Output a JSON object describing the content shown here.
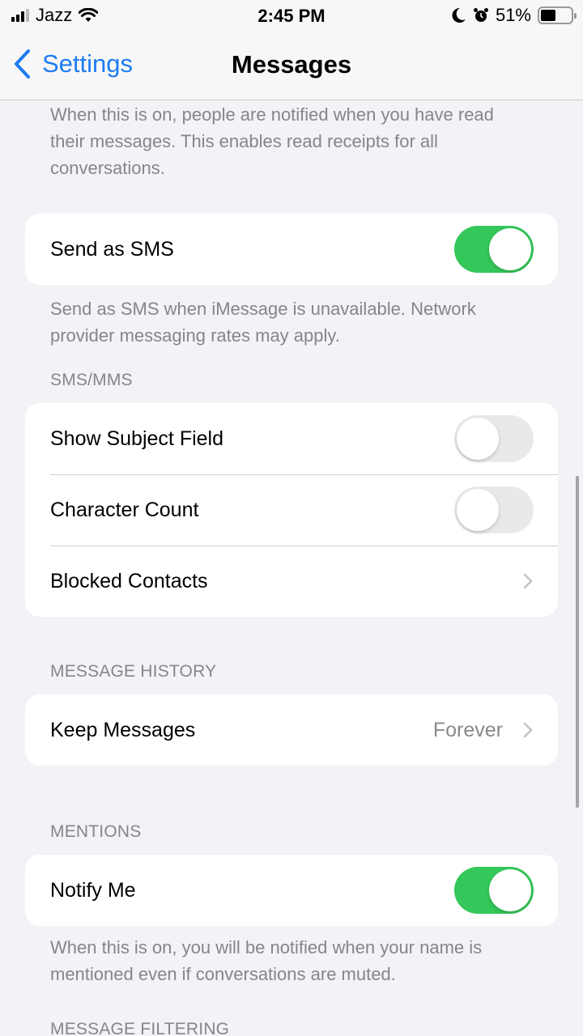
{
  "status_bar": {
    "carrier": "Jazz",
    "time": "2:45 PM",
    "battery_percent": "51%",
    "battery_level": 0.51,
    "icons": [
      "signal-icon",
      "wifi-icon",
      "moon-icon",
      "alarm-icon",
      "battery-icon"
    ]
  },
  "nav": {
    "back_label": "Settings",
    "title": "Messages"
  },
  "read_receipts_footer": "When this is on, people are notified when you have read their messages. This enables read receipts for all conversations.",
  "send_as_sms": {
    "label": "Send as SMS",
    "on": true,
    "footer": "Send as SMS when iMessage is unavailable. Network provider messaging rates may apply."
  },
  "sms_mms": {
    "header": "SMS/MMS",
    "rows": [
      {
        "label": "Show Subject Field",
        "type": "toggle",
        "on": false
      },
      {
        "label": "Character Count",
        "type": "toggle",
        "on": false
      },
      {
        "label": "Blocked Contacts",
        "type": "link"
      }
    ]
  },
  "message_history": {
    "header": "MESSAGE HISTORY",
    "rows": [
      {
        "label": "Keep Messages",
        "value": "Forever",
        "type": "link"
      }
    ]
  },
  "mentions": {
    "header": "MENTIONS",
    "rows": [
      {
        "label": "Notify Me",
        "type": "toggle",
        "on": true
      }
    ],
    "footer": "When this is on, you will be notified when your name is mentioned even if conversations are muted."
  },
  "message_filtering": {
    "header": "MESSAGE FILTERING"
  },
  "colors": {
    "accent": "#1e7cf2",
    "toggle_on": "#34c759",
    "toggle_off": "#e9e9ea",
    "background": "#f2f2f7",
    "secondary_text": "#85858a"
  }
}
